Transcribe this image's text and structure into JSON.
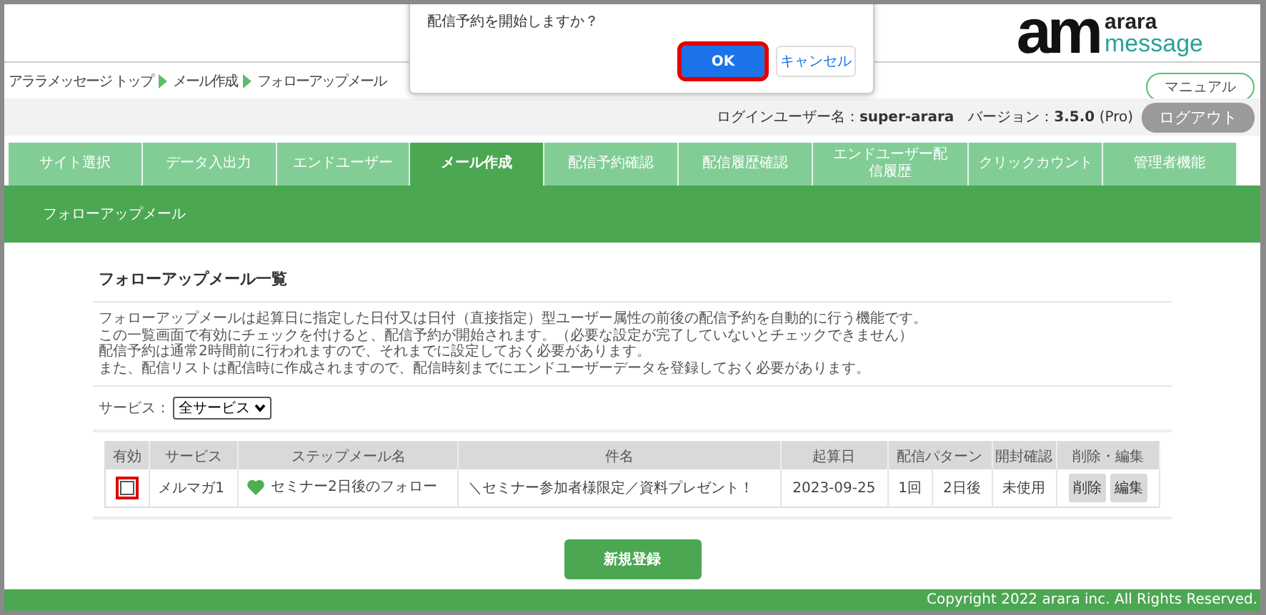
{
  "dialog": {
    "message": "配信予約を開始しますか？",
    "buttons": [
      {
        "label": "OK",
        "kind": "primary",
        "highlighted": true
      },
      {
        "label": "キャンセル",
        "kind": "secondary",
        "highlighted": false
      }
    ]
  },
  "logo": {
    "mark": "am",
    "lines": [
      "arara",
      "message"
    ]
  },
  "breadcrumb": [
    "アララメッセージ トップ",
    "メール作成",
    "フォローアップメール"
  ],
  "manual_button": "マニュアル",
  "login_info": "ログインユーザー名：**super-arara**　バージョン：**3.5.0** (Pro)",
  "logout_button": "ログアウト",
  "tabs": [
    {
      "label": "サイト選択",
      "selected": false
    },
    {
      "label": "データ入出力",
      "selected": false
    },
    {
      "label": "エンドユーザー",
      "selected": false
    },
    {
      "label": "メール作成",
      "selected": true
    },
    {
      "label": "配信予約確認",
      "selected": false
    },
    {
      "label": "配信履歴確認",
      "selected": false
    },
    {
      "label": "エンドユーザー配信履歴",
      "selected": false
    },
    {
      "label": "クリックカウント",
      "selected": false
    },
    {
      "label": "管理者機能",
      "selected": false
    }
  ],
  "section_title": "フォローアップメール",
  "panel": {
    "title": "フォローアップメール一覧",
    "description": [
      "フォローアップメールは起算日に指定した日付又は日付（直接指定）型ユーザー属性の前後の配信予約を自動的に行う機能です。",
      "この一覧画面で有効にチェックを付けると、配信予約が開始されます。（必要な設定が完了していないとチェックできません）",
      "配信予約は通常2時間前に行われますので、それまでに設定しておく必要があります。",
      "また、配信リストは配信時に作成されますので、配信時刻までにエンドユーザーデータを登録しておく必要があります。"
    ],
    "filter_label": "サービス：",
    "filter_value": "全サービス"
  },
  "table": {
    "columns": [
      "有効",
      "サービス",
      "ステップメール名",
      "件名",
      "起算日",
      "配信パターン",
      "開封確認",
      "削除・編集"
    ],
    "rows": [
      {
        "enabled": false,
        "highlighted": true,
        "service": "メルマガ1",
        "name": "セミナー2日後のフォロー",
        "color": "#4caf50",
        "subject": "＼セミナー参加者様限定／資料プレゼント！",
        "start_date": "2023-09-25",
        "pattern": [
          "1回",
          "2日後"
        ],
        "open_check": "未使用",
        "actions": [
          "削除",
          "編集"
        ]
      }
    ]
  },
  "new_button": "新規登録",
  "footer": "Copyright 2022 arara inc. All Rights Reserved."
}
